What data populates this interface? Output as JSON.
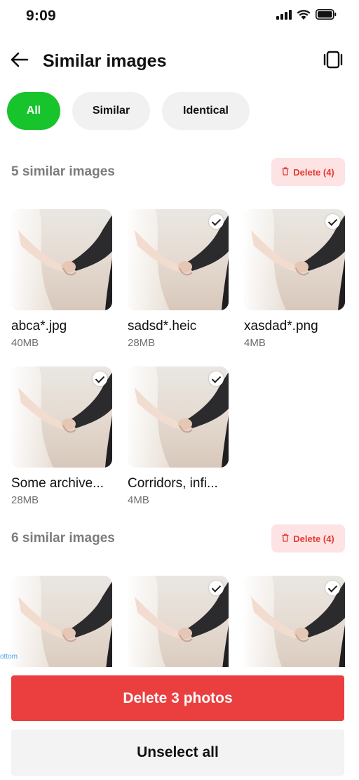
{
  "status_bar": {
    "time": "9:09",
    "icons": [
      "cellular-signal-icon",
      "wifi-icon",
      "battery-icon"
    ]
  },
  "header": {
    "title": "Similar images",
    "back_icon": "arrow-left-icon",
    "compare_icon": "compare-view-icon"
  },
  "filters": {
    "chips": [
      {
        "label": "All",
        "active": true
      },
      {
        "label": "Similar",
        "active": false
      },
      {
        "label": "Identical",
        "active": false
      }
    ]
  },
  "groups": [
    {
      "title": "5 similar images",
      "delete_label": "Delete (4)",
      "items": [
        {
          "name": "abca*.jpg",
          "size": "40MB",
          "selected": false
        },
        {
          "name": "sadsd*.heic",
          "size": "28MB",
          "selected": true
        },
        {
          "name": "xasdad*.png",
          "size": "4MB",
          "selected": true
        },
        {
          "name": "Some archive...",
          "size": "28MB",
          "selected": true
        },
        {
          "name": "Corridors, infi...",
          "size": "4MB",
          "selected": true
        }
      ]
    },
    {
      "title": "6 similar images",
      "delete_label": "Delete (4)",
      "items": [
        {
          "selected": false
        },
        {
          "selected": true
        },
        {
          "selected": true
        }
      ]
    }
  ],
  "overlay_label": "ottom",
  "actions": {
    "delete_label": "Delete 3 photos",
    "unselect_label": "Unselect all"
  },
  "colors": {
    "accent_green": "#17c42c",
    "danger_red": "#eb3f3f",
    "danger_light": "#fde3e3",
    "chip_gray": "#f1f1f1"
  }
}
